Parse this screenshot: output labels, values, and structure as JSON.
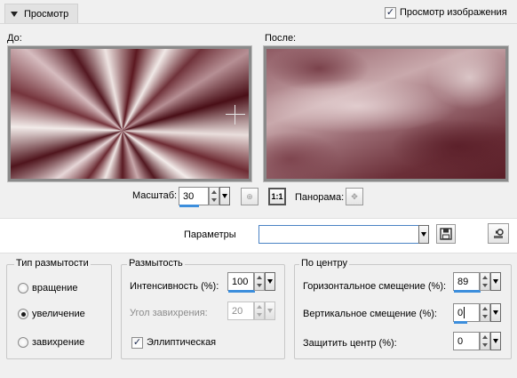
{
  "header": {
    "preview_tab": "Просмотр",
    "show_preview_label": "Просмотр изображения",
    "show_preview_checked": true
  },
  "preview": {
    "before_label": "До:",
    "after_label": "После:",
    "zoom_label": "Масштаб:",
    "zoom_value": "30",
    "pan_label": "Панорама:",
    "actual_size_label": "1:1"
  },
  "presets": {
    "label": "Параметры",
    "value": ""
  },
  "blur_type": {
    "title": "Тип размытости",
    "options": [
      "вращение",
      "увеличение",
      "завихрение"
    ],
    "selected": "увеличение"
  },
  "blur": {
    "title": "Размытость",
    "intensity_label": "Интенсивность (%):",
    "intensity_value": "100",
    "twirl_label": "Угол завихрения:",
    "twirl_value": "20",
    "elliptical_label": "Эллиптическая",
    "elliptical_checked": true
  },
  "center": {
    "title": "По центру",
    "h_offset_label": "Горизонтальное смещение (%):",
    "h_offset_value": "89",
    "v_offset_label": "Вертикальное смещение (%):",
    "v_offset_value": "0",
    "protect_label": "Защитить центр (%):",
    "protect_value": "0"
  },
  "colors": {
    "accent": "#3c8edc",
    "combo_border": "#4a83c4"
  }
}
